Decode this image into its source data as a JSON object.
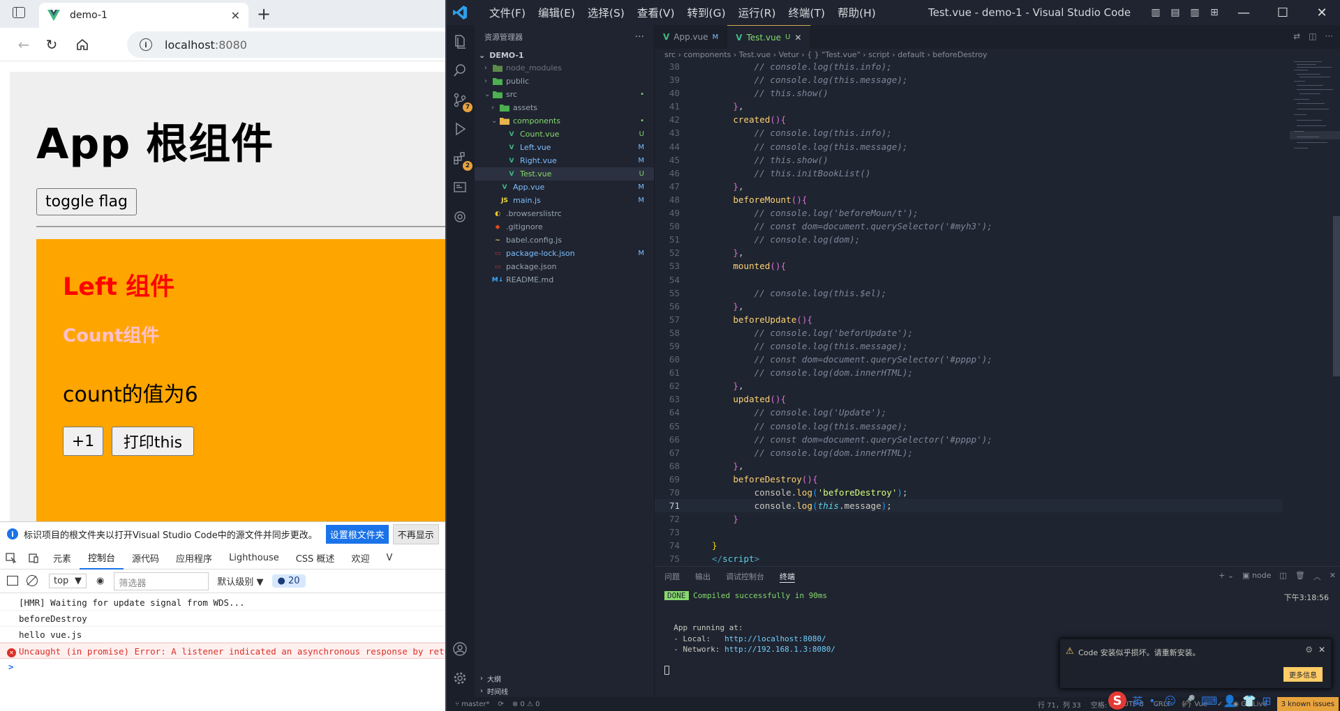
{
  "browser": {
    "tab_title": "demo-1",
    "url_host": "localhost",
    "url_port": ":8080",
    "app_title": "App 根组件",
    "toggle_label": "toggle flag",
    "left_title": "Left 组件",
    "count_title": "Count组件",
    "count_value": "count的值为6",
    "plus_label": "+1",
    "print_label": "打印this",
    "colors": {
      "left_bg": "#ffa500",
      "left_title": "#ff0000",
      "count_title": "#ffc0cb"
    }
  },
  "devtools": {
    "banner_text": "标识项目的根文件夹以打开Visual Studio Code中的源文件并同步更改。",
    "banner_set_btn": "设置根文件夹",
    "banner_dismiss_btn": "不再显示",
    "tabs": [
      "元素",
      "控制台",
      "源代码",
      "应用程序",
      "Lighthouse",
      "CSS 概述",
      "欢迎",
      "V"
    ],
    "active_tab_index": 1,
    "context": "top",
    "filter_placeholder": "筛选器",
    "level": "默认级别",
    "message_count": "20",
    "console": [
      "[HMR] Waiting for update signal from WDS...",
      "beforeDestroy",
      "hello vue.js"
    ],
    "error_line": "Uncaught (in promise) Error: A listener indicated an asynchronous response by retu",
    "prompt": ">"
  },
  "vscode": {
    "menus": [
      "文件(F)",
      "编辑(E)",
      "选择(S)",
      "查看(V)",
      "转到(G)",
      "运行(R)",
      "终端(T)",
      "帮助(H)"
    ],
    "window_title": "Test.vue - demo-1 - Visual Studio Code",
    "explorer_title": "资源管理器",
    "root": "DEMO-1",
    "tree": [
      {
        "name": "node_modules",
        "depth": 1,
        "chev": "›",
        "icon": "folder-node",
        "color": "#6b7280",
        "status": ""
      },
      {
        "name": "public",
        "depth": 1,
        "chev": "›",
        "icon": "folder-public",
        "color": "#9aa4b2",
        "status": ""
      },
      {
        "name": "src",
        "depth": 1,
        "chev": "⌄",
        "icon": "folder-src",
        "color": "#9aa4b2",
        "status": "•"
      },
      {
        "name": "assets",
        "depth": 2,
        "chev": "›",
        "icon": "folder-assets",
        "color": "#9aa4b2",
        "status": ""
      },
      {
        "name": "components",
        "depth": 2,
        "chev": "⌄",
        "icon": "folder-components",
        "color": "#87d96c",
        "status": "•"
      },
      {
        "name": "Count.vue",
        "depth": 3,
        "chev": "",
        "icon": "vue",
        "color": "#87d96c",
        "status": "U"
      },
      {
        "name": "Left.vue",
        "depth": 3,
        "chev": "",
        "icon": "vue",
        "color": "#80bfff",
        "status": "M"
      },
      {
        "name": "Right.vue",
        "depth": 3,
        "chev": "",
        "icon": "vue",
        "color": "#80bfff",
        "status": "M"
      },
      {
        "name": "Test.vue",
        "depth": 3,
        "chev": "",
        "icon": "vue",
        "color": "#87d96c",
        "status": "U"
      },
      {
        "name": "App.vue",
        "depth": 2,
        "chev": "",
        "icon": "vue",
        "color": "#80bfff",
        "status": "M"
      },
      {
        "name": "main.js",
        "depth": 2,
        "chev": "",
        "icon": "js",
        "color": "#80bfff",
        "status": "M"
      },
      {
        "name": ".browserslistrc",
        "depth": 1,
        "chev": "",
        "icon": "browserslist",
        "color": "#9aa4b2",
        "status": ""
      },
      {
        "name": ".gitignore",
        "depth": 1,
        "chev": "",
        "icon": "git",
        "color": "#9aa4b2",
        "status": ""
      },
      {
        "name": "babel.config.js",
        "depth": 1,
        "chev": "",
        "icon": "babel",
        "color": "#9aa4b2",
        "status": ""
      },
      {
        "name": "package-lock.json",
        "depth": 1,
        "chev": "",
        "icon": "npm",
        "color": "#80bfff",
        "status": "M"
      },
      {
        "name": "package.json",
        "depth": 1,
        "chev": "",
        "icon": "npm",
        "color": "#9aa4b2",
        "status": ""
      },
      {
        "name": "README.md",
        "depth": 1,
        "chev": "",
        "icon": "markdown",
        "color": "#9aa4b2",
        "status": ""
      }
    ],
    "selected_index": 8,
    "outline": "大纲",
    "timeline": "时间线",
    "tabs": [
      {
        "name": "App.vue",
        "badge": "M",
        "active": false
      },
      {
        "name": "Test.vue",
        "badge": "U",
        "active": true
      }
    ],
    "breadcrumb": "src  ›  components  ›  Test.vue  ›  Vetur  ›  { } \"Test.vue\"  ›  script  ›  default  ›  beforeDestroy",
    "cursor_line": 71,
    "code": [
      {
        "n": 38,
        "t": [
          [
            "        ",
            "plain"
          ],
          [
            "// console.log(this.info);",
            "com"
          ]
        ]
      },
      {
        "n": 39,
        "t": [
          [
            "        ",
            "plain"
          ],
          [
            "// console.log(this.message);",
            "com"
          ]
        ]
      },
      {
        "n": 40,
        "t": [
          [
            "        ",
            "plain"
          ],
          [
            "// this.show()",
            "com"
          ]
        ]
      },
      {
        "n": 41,
        "t": [
          [
            "    ",
            "plain"
          ],
          [
            "}",
            "brk2"
          ],
          [
            ",",
            "pun"
          ]
        ]
      },
      {
        "n": 42,
        "t": [
          [
            "    ",
            "plain"
          ],
          [
            "created",
            "fn"
          ],
          [
            "()",
            "brk2"
          ],
          [
            "{",
            "brk2"
          ]
        ]
      },
      {
        "n": 43,
        "t": [
          [
            "        ",
            "plain"
          ],
          [
            "// console.log(this.info);",
            "com"
          ]
        ]
      },
      {
        "n": 44,
        "t": [
          [
            "        ",
            "plain"
          ],
          [
            "// console.log(this.message);",
            "com"
          ]
        ]
      },
      {
        "n": 45,
        "t": [
          [
            "        ",
            "plain"
          ],
          [
            "// this.show()",
            "com"
          ]
        ]
      },
      {
        "n": 46,
        "t": [
          [
            "        ",
            "plain"
          ],
          [
            "// this.initBookList()",
            "com"
          ]
        ]
      },
      {
        "n": 47,
        "t": [
          [
            "    ",
            "plain"
          ],
          [
            "}",
            "brk2"
          ],
          [
            ",",
            "pun"
          ]
        ]
      },
      {
        "n": 48,
        "t": [
          [
            "    ",
            "plain"
          ],
          [
            "beforeMount",
            "fn"
          ],
          [
            "()",
            "brk2"
          ],
          [
            "{",
            "brk2"
          ]
        ]
      },
      {
        "n": 49,
        "t": [
          [
            "        ",
            "plain"
          ],
          [
            "// console.log('beforeMoun/t');",
            "com"
          ]
        ]
      },
      {
        "n": 50,
        "t": [
          [
            "        ",
            "plain"
          ],
          [
            "// const dom=document.querySelector('#myh3');",
            "com"
          ]
        ]
      },
      {
        "n": 51,
        "t": [
          [
            "        ",
            "plain"
          ],
          [
            "// console.log(dom);",
            "com"
          ]
        ]
      },
      {
        "n": 52,
        "t": [
          [
            "    ",
            "plain"
          ],
          [
            "}",
            "brk2"
          ],
          [
            ",",
            "pun"
          ]
        ]
      },
      {
        "n": 53,
        "t": [
          [
            "    ",
            "plain"
          ],
          [
            "mounted",
            "fn"
          ],
          [
            "()",
            "brk2"
          ],
          [
            "{",
            "brk2"
          ]
        ]
      },
      {
        "n": 54,
        "t": [
          [
            "",
            "plain"
          ]
        ]
      },
      {
        "n": 55,
        "t": [
          [
            "        ",
            "plain"
          ],
          [
            "// console.log(this.$el);",
            "com"
          ]
        ]
      },
      {
        "n": 56,
        "t": [
          [
            "    ",
            "plain"
          ],
          [
            "}",
            "brk2"
          ],
          [
            ",",
            "pun"
          ]
        ]
      },
      {
        "n": 57,
        "t": [
          [
            "    ",
            "plain"
          ],
          [
            "beforeUpdate",
            "fn"
          ],
          [
            "()",
            "brk2"
          ],
          [
            "{",
            "brk2"
          ]
        ]
      },
      {
        "n": 58,
        "t": [
          [
            "        ",
            "plain"
          ],
          [
            "// console.log('beforUpdate');",
            "com"
          ]
        ]
      },
      {
        "n": 59,
        "t": [
          [
            "        ",
            "plain"
          ],
          [
            "// console.log(this.message);",
            "com"
          ]
        ]
      },
      {
        "n": 60,
        "t": [
          [
            "        ",
            "plain"
          ],
          [
            "// const dom=document.querySelector('#pppp');",
            "com"
          ]
        ]
      },
      {
        "n": 61,
        "t": [
          [
            "        ",
            "plain"
          ],
          [
            "// console.log(dom.innerHTML);",
            "com"
          ]
        ]
      },
      {
        "n": 62,
        "t": [
          [
            "    ",
            "plain"
          ],
          [
            "}",
            "brk2"
          ],
          [
            ",",
            "pun"
          ]
        ]
      },
      {
        "n": 63,
        "t": [
          [
            "    ",
            "plain"
          ],
          [
            "updated",
            "fn"
          ],
          [
            "()",
            "brk2"
          ],
          [
            "{",
            "brk2"
          ]
        ]
      },
      {
        "n": 64,
        "t": [
          [
            "        ",
            "plain"
          ],
          [
            "// console.log('Update');",
            "com"
          ]
        ]
      },
      {
        "n": 65,
        "t": [
          [
            "        ",
            "plain"
          ],
          [
            "// console.log(this.message);",
            "com"
          ]
        ]
      },
      {
        "n": 66,
        "t": [
          [
            "        ",
            "plain"
          ],
          [
            "// const dom=document.querySelector('#pppp');",
            "com"
          ]
        ]
      },
      {
        "n": 67,
        "t": [
          [
            "        ",
            "plain"
          ],
          [
            "// console.log(dom.innerHTML);",
            "com"
          ]
        ]
      },
      {
        "n": 68,
        "t": [
          [
            "    ",
            "plain"
          ],
          [
            "}",
            "brk2"
          ],
          [
            ",",
            "pun"
          ]
        ]
      },
      {
        "n": 69,
        "t": [
          [
            "    ",
            "plain"
          ],
          [
            "beforeDestroy",
            "fn"
          ],
          [
            "()",
            "brk2"
          ],
          [
            "{",
            "brk2"
          ]
        ]
      },
      {
        "n": 70,
        "t": [
          [
            "        ",
            "plain"
          ],
          [
            "console",
            "plain"
          ],
          [
            ".",
            "pun"
          ],
          [
            "log",
            "mth"
          ],
          [
            "(",
            "brk3"
          ],
          [
            "'beforeDestroy'",
            "str"
          ],
          [
            ")",
            "brk3"
          ],
          [
            ";",
            "pun"
          ]
        ]
      },
      {
        "n": 71,
        "t": [
          [
            "        ",
            "plain"
          ],
          [
            "console",
            "plain"
          ],
          [
            ".",
            "pun"
          ],
          [
            "log",
            "mth"
          ],
          [
            "(",
            "brk3"
          ],
          [
            "this",
            "this"
          ],
          [
            ".",
            "pun"
          ],
          [
            "message",
            "plain"
          ],
          [
            ")",
            "brk3"
          ],
          [
            ";",
            "pun"
          ]
        ]
      },
      {
        "n": 72,
        "t": [
          [
            "    ",
            "plain"
          ],
          [
            "}",
            "brk2"
          ]
        ]
      },
      {
        "n": 73,
        "t": [
          [
            "",
            "plain"
          ]
        ]
      },
      {
        "n": 74,
        "t": [
          [
            "",
            "plain"
          ],
          [
            "}",
            "brk1"
          ]
        ]
      },
      {
        "n": 75,
        "t": [
          [
            "",
            "plain"
          ],
          [
            "</",
            "ang"
          ],
          [
            "script",
            "tag"
          ],
          [
            ">",
            "ang"
          ]
        ]
      }
    ],
    "panel_tabs": [
      "问题",
      "输出",
      "调试控制台",
      "终端"
    ],
    "panel_active_index": 3,
    "panel_shell": "node",
    "terminal": {
      "done_badge": "DONE",
      "compiled": "Compiled successfully in 90ms",
      "time": "下午3:18:56",
      "app_running": "  App running at:",
      "local_label": "  - Local:   ",
      "local_url": "http://localhost:8080/",
      "network_label": "  - Network: ",
      "network_url": "http://192.168.1.3:8080/"
    },
    "notification": {
      "message": "Code 安装似乎损坏。请重新安装。",
      "button": "更多信息"
    },
    "status": {
      "branch": "master*",
      "errors": "0",
      "warnings": "0",
      "position": "行 71，列 33",
      "spaces": "空格: 4",
      "encoding": "UTF-8",
      "eol": "CRLF",
      "language": "Vue",
      "golive": "Go Live",
      "issues": "3 known issues"
    },
    "ime_label": "英"
  }
}
